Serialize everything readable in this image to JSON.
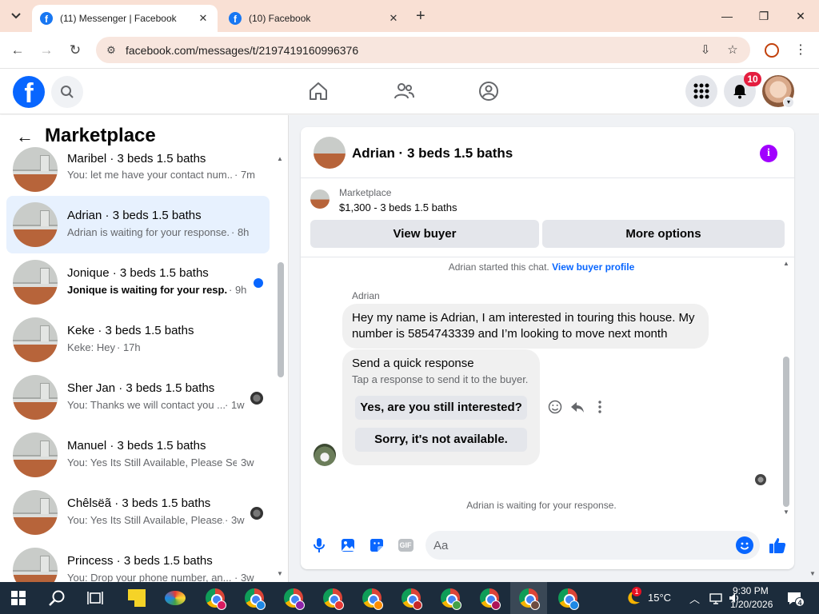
{
  "browser": {
    "tabs": [
      {
        "title": "(11) Messenger | Facebook",
        "active": true
      },
      {
        "title": "(10) Facebook",
        "active": false
      }
    ],
    "url": "facebook.com/messages/t/2197419160996376",
    "icons": {
      "tab_menu": "chevron-down-icon",
      "new_tab": "+",
      "minimize": "—",
      "maximize": "❐",
      "close": "✕",
      "back": "←",
      "forward": "→",
      "reload": "↻",
      "site_info": "⚙",
      "install": "⇩",
      "bookmark": "☆",
      "menu": "⋮"
    }
  },
  "fb_header": {
    "logo": "f",
    "notifications_count": "10",
    "colors": {
      "brand": "#0866ff",
      "badge": "#e41e3f"
    }
  },
  "left_panel": {
    "back_icon": "←",
    "title": "Marketplace",
    "conversations": [
      {
        "name": "Maribel · 3 beds 1.5 baths",
        "snippet": "You: let me have your contact num...",
        "time": "· 7m"
      },
      {
        "name": "Adrian · 3 beds 1.5 baths",
        "snippet": "Adrian is waiting for your response.",
        "time": "· 8h",
        "selected": true
      },
      {
        "name": "Jonique · 3 beds 1.5 baths",
        "snippet": "Jonique is waiting for your resp...",
        "time": "· 9h",
        "unread": true
      },
      {
        "name": "Keke · 3 beds 1.5 baths",
        "snippet": "Keke: Hey",
        "time": "· 17h"
      },
      {
        "name": "Sher Jan · 3 beds 1.5 baths",
        "snippet": "You: Thanks we will contact you ...",
        "time": "· 1w"
      },
      {
        "name": "Manuel · 3 beds 1.5 baths",
        "snippet": "You: Yes Its Still Available, Please Se...",
        "time": "· 3w"
      },
      {
        "name": "Chêlsëã · 3 beds 1.5 baths",
        "snippet": "You: Yes Its Still Available, Please...",
        "time": "· 3w"
      },
      {
        "name": "Princess · 3 beds 1.5 baths",
        "snippet": "You: Drop your phone number, an...",
        "time": "· 3w"
      }
    ]
  },
  "chat": {
    "title": "Adrian · 3 beds 1.5 baths",
    "info_icon": "i",
    "listing_source": "Marketplace",
    "listing": "$1,300 - 3 beds 1.5 baths",
    "buttons": {
      "view_buyer": "View buyer",
      "more_options": "More options"
    },
    "started_text": "Adrian started this chat.",
    "view_profile_link": "View buyer profile",
    "sender": "Adrian",
    "message": "Hey my name is Adrian, I am  interested in touring this house. My number is 5854743339 and I’m looking to move next month",
    "quick_response": {
      "title": "Send a quick response",
      "subtitle": "Tap a response to send it to the buyer.",
      "options": [
        "Yes, are you still interested?",
        "Sorry, it's not available."
      ]
    },
    "waiting_text": "Adrian is waiting for your response.",
    "composer_placeholder": "Aa",
    "gif_label": "GIF"
  },
  "taskbar": {
    "weather": "15°C",
    "weather_badge": "1",
    "time": "9:30 PM",
    "date": "1/20/2026",
    "notification_count": "4"
  }
}
